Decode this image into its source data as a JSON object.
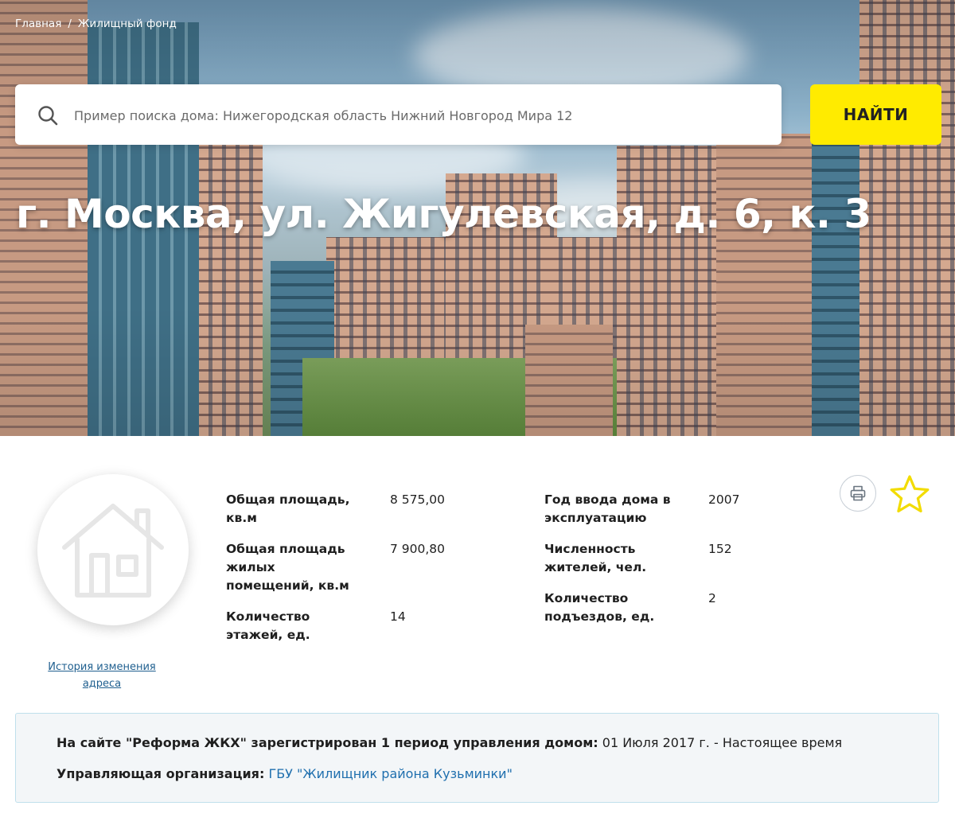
{
  "breadcrumb": {
    "home": "Главная",
    "separator": "/",
    "current": "Жилищный фонд"
  },
  "search": {
    "placeholder": "Пример поиска дома: Нижегородская область Нижний Новгород Мира 12",
    "button_label": "НАЙТИ",
    "icon": "search-icon"
  },
  "house": {
    "title": "г. Москва, ул. Жигулевская, д. 6, к. 3",
    "photo_icon": "house-icon",
    "history_link": "История изменения адреса"
  },
  "stats": {
    "total_area": {
      "label": "Общая площадь, кв.м",
      "value": "8 575,00"
    },
    "living_area": {
      "label": "Общая площадь жилых помещений, кв.м",
      "value": "7 900,80"
    },
    "floors": {
      "label": "Количество этажей, ед.",
      "value": "14"
    },
    "year": {
      "label": "Год ввода дома в эксплуатацию",
      "value": "2007"
    },
    "residents": {
      "label": "Численность жителей, чел.",
      "value": "152"
    },
    "entrances": {
      "label": "Количество подъездов, ед.",
      "value": "2"
    }
  },
  "actions": {
    "print_icon": "printer-icon",
    "favorite_icon": "star-icon"
  },
  "notice": {
    "period_label": "На сайте \"Реформа ЖКХ\" зарегистрирован 1 период управления домом:",
    "period_value": "01 Июля 2017 г. - Настоящее время",
    "org_label": "Управляющая организация:",
    "org_value": "ГБУ \"Жилищник района Кузьминки\""
  },
  "colors": {
    "accent_yellow": "#ffeb00",
    "link_blue": "#1f6fae",
    "notice_border": "#bfe0ec"
  }
}
